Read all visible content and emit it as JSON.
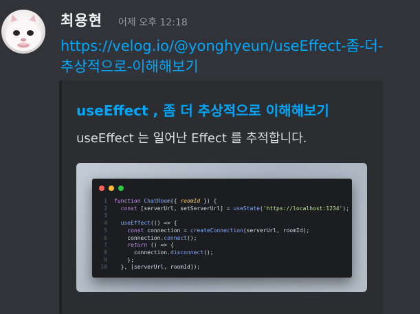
{
  "message": {
    "author": "최용현",
    "timestamp": "어제 오후 12:18",
    "link": "https://velog.io/@yonghyeun/useEffect-좀-더-추상적으로-이해해보기"
  },
  "embed": {
    "title": "useEffect , 좀 더 추상적으로 이해해보기",
    "description": "useEffect 는 일어난 Effect 를 추적합니다.",
    "image": {
      "code_lines": [
        {
          "n": "1",
          "tokens": [
            {
              "t": "function ",
              "c": "kw"
            },
            {
              "t": "ChatRoom",
              "c": "fn"
            },
            {
              "t": "({ "
            },
            {
              "t": "roomId",
              "c": "var"
            },
            {
              "t": " }) {"
            }
          ]
        },
        {
          "n": "2",
          "tokens": [
            {
              "t": "  "
            },
            {
              "t": "const ",
              "c": "kw"
            },
            {
              "t": "[serverUrl, setServerUrl] = "
            },
            {
              "t": "useState",
              "c": "fn"
            },
            {
              "t": "("
            },
            {
              "t": "'https://localhost:1234'",
              "c": "str"
            },
            {
              "t": ");"
            }
          ]
        },
        {
          "n": "3",
          "tokens": []
        },
        {
          "n": "4",
          "tokens": [
            {
              "t": "  "
            },
            {
              "t": "useEffect",
              "c": "fn"
            },
            {
              "t": "(() => {"
            }
          ]
        },
        {
          "n": "5",
          "tokens": [
            {
              "t": "    "
            },
            {
              "t": "const ",
              "c": "kw"
            },
            {
              "t": "connection = "
            },
            {
              "t": "createConnection",
              "c": "fn"
            },
            {
              "t": "(serverUrl, roomId);"
            }
          ]
        },
        {
          "n": "6",
          "tokens": [
            {
              "t": "    connection."
            },
            {
              "t": "connect",
              "c": "fn"
            },
            {
              "t": "();"
            }
          ]
        },
        {
          "n": "7",
          "tokens": [
            {
              "t": "    "
            },
            {
              "t": "return",
              "c": "kw it"
            },
            {
              "t": " () => {"
            }
          ]
        },
        {
          "n": "8",
          "tokens": [
            {
              "t": "      connection."
            },
            {
              "t": "disconnect",
              "c": "fn"
            },
            {
              "t": "();"
            }
          ]
        },
        {
          "n": "9",
          "tokens": [
            {
              "t": "    };"
            }
          ]
        },
        {
          "n": "10",
          "tokens": [
            {
              "t": "  }, [serverUrl, roomId]);"
            }
          ]
        }
      ]
    }
  }
}
